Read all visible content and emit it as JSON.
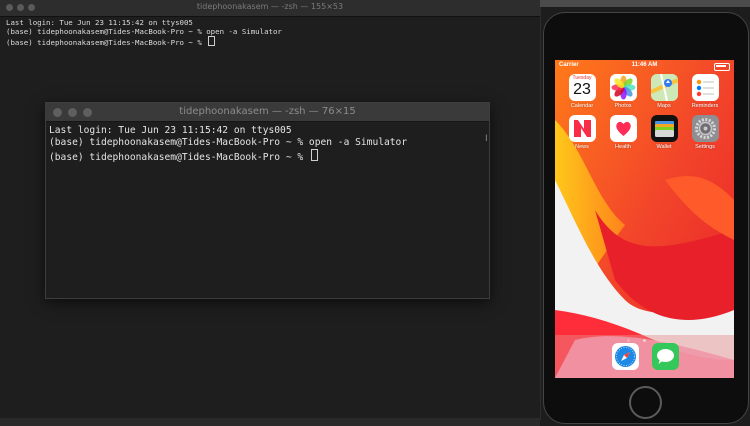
{
  "back_terminal": {
    "title": "tidephoonakasem — -zsh — 155×53",
    "lines": [
      "Last login: Tue Jun 23 11:15:42 on ttys005",
      "(base) tidephoonakasem@Tides-MacBook-Pro ~ % open -a Simulator",
      "(base) tidephoonakasem@Tides-MacBook-Pro ~ % "
    ]
  },
  "front_terminal": {
    "title": "tidephoonakasem — -zsh — 76×15",
    "lines": [
      "Last login: Tue Jun 23 11:15:42 on ttys005",
      "(base) tidephoonakasem@Tides-MacBook-Pro ~ % open -a Simulator",
      "(base) tidephoonakasem@Tides-MacBook-Pro ~ % "
    ]
  },
  "simulator": {
    "status": {
      "carrier": "Carrier",
      "time": "11:46 AM"
    },
    "apps": [
      {
        "label": "Calendar",
        "icon": "calendar-icon",
        "day": "Tuesday",
        "date": "23"
      },
      {
        "label": "Photos",
        "icon": "photos-icon"
      },
      {
        "label": "Maps",
        "icon": "maps-icon"
      },
      {
        "label": "Reminders",
        "icon": "reminders-icon"
      },
      {
        "label": "News",
        "icon": "news-icon"
      },
      {
        "label": "Health",
        "icon": "health-icon"
      },
      {
        "label": "Wallet",
        "icon": "wallet-icon"
      },
      {
        "label": "Settings",
        "icon": "settings-icon"
      }
    ],
    "dock": [
      {
        "icon": "safari-icon"
      },
      {
        "icon": "messages-icon"
      }
    ]
  }
}
